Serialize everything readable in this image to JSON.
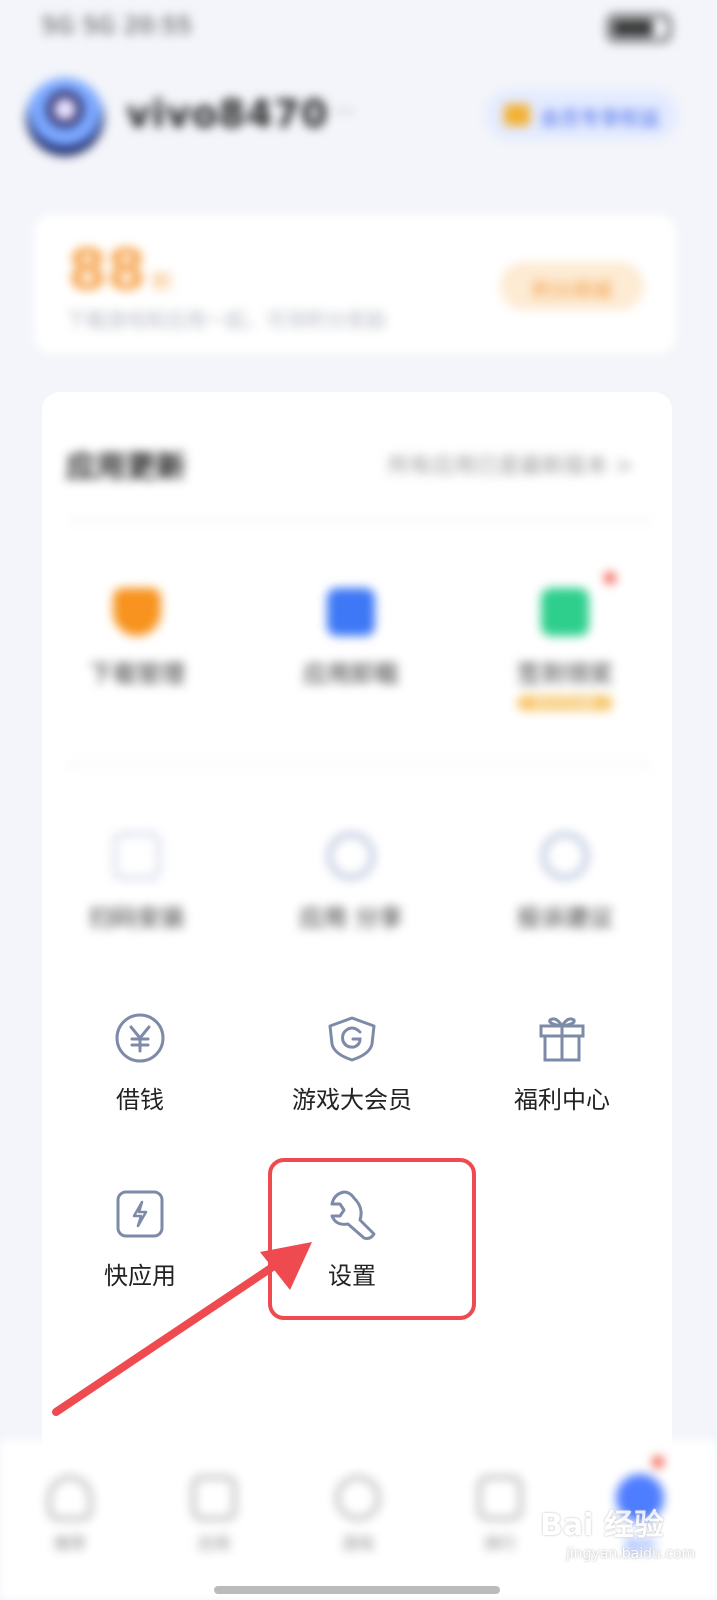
{
  "status_bar": {
    "left_text": "5G 5G 20:55"
  },
  "profile": {
    "username": "vivo8470",
    "username_suffix": "···",
    "vip_button_label": "会员专享权益"
  },
  "points_card": {
    "value": "88",
    "unit": "积",
    "description": "下载游戏和应用一起，可领积分奖励",
    "button_label": "积分商城"
  },
  "apps_section": {
    "title": "应用更新",
    "link_text": "所有应用已是最新版本 >",
    "row1": [
      {
        "label": "下载管理",
        "icon": "download-icon",
        "color": "#f7931e"
      },
      {
        "label": "应用卸载",
        "icon": "trash-icon",
        "color": "#3e78f6"
      },
      {
        "label": "签到领奖",
        "icon": "gift-icon",
        "color": "#2ecf8d",
        "badge": "积分可兑换"
      }
    ],
    "row2": [
      {
        "label": "扫码安装",
        "icon": "qr-icon"
      },
      {
        "label": "应用 分享",
        "icon": "sync-icon"
      },
      {
        "label": "投诉建议",
        "icon": "chat-icon"
      }
    ]
  },
  "menu": {
    "row1": [
      {
        "label": "借钱",
        "icon": "yen-icon"
      },
      {
        "label": "游戏大会员",
        "icon": "game-g-icon"
      },
      {
        "label": "福利中心",
        "icon": "gift-box-icon"
      }
    ],
    "row2": [
      {
        "label": "快应用",
        "icon": "quick-app-icon"
      },
      {
        "label": "设置",
        "icon": "wrench-icon"
      }
    ]
  },
  "bottom_nav": [
    {
      "label": "推荐",
      "icon": "heart-icon"
    },
    {
      "label": "应用",
      "icon": "apps-icon"
    },
    {
      "label": "游戏",
      "icon": "gamepad-icon"
    },
    {
      "label": "排行",
      "icon": "rank-icon"
    },
    {
      "label": "我的",
      "icon": "user-icon"
    }
  ],
  "watermark": {
    "main": "Bai 经验",
    "sub": "jingyan.baidu.com"
  },
  "colors": {
    "highlight": "#ee4a4f",
    "accent": "#4f7dff",
    "icon_stroke": "#7d8aa8"
  }
}
